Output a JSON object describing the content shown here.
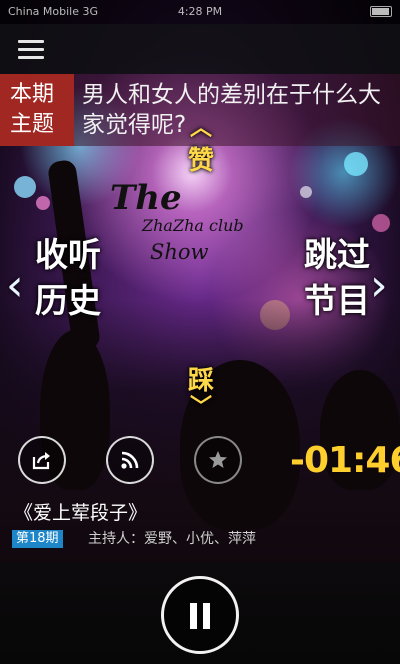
{
  "status_bar": {
    "carrier": "China Mobile 3G",
    "time": "4:28 PM"
  },
  "topic": {
    "tag_line1": "本期",
    "tag_line2": "主题",
    "question": "男人和女人的差别在于什么大家觉得呢?"
  },
  "logo": {
    "the": "The",
    "club": "ZhaZha club",
    "show": "Show"
  },
  "gestures": {
    "like": "赞",
    "dislike": "踩",
    "history_line1": "收听",
    "history_line2": "历史",
    "skip_line1": "跳过",
    "skip_line2": "节目"
  },
  "player": {
    "countdown": "-01:46",
    "program_title": "《爱上荤段子》",
    "episode": "第18期",
    "hosts": "主持人：爱野、小优、萍萍"
  },
  "icons": {
    "menu": "hamburger-icon",
    "share": "share-icon",
    "rss": "rss-icon",
    "favorite": "star-icon",
    "pause": "pause-icon"
  },
  "colors": {
    "accent": "#ffcf2e",
    "tag_red": "#a12722",
    "episode_blue": "#1c86c8"
  }
}
